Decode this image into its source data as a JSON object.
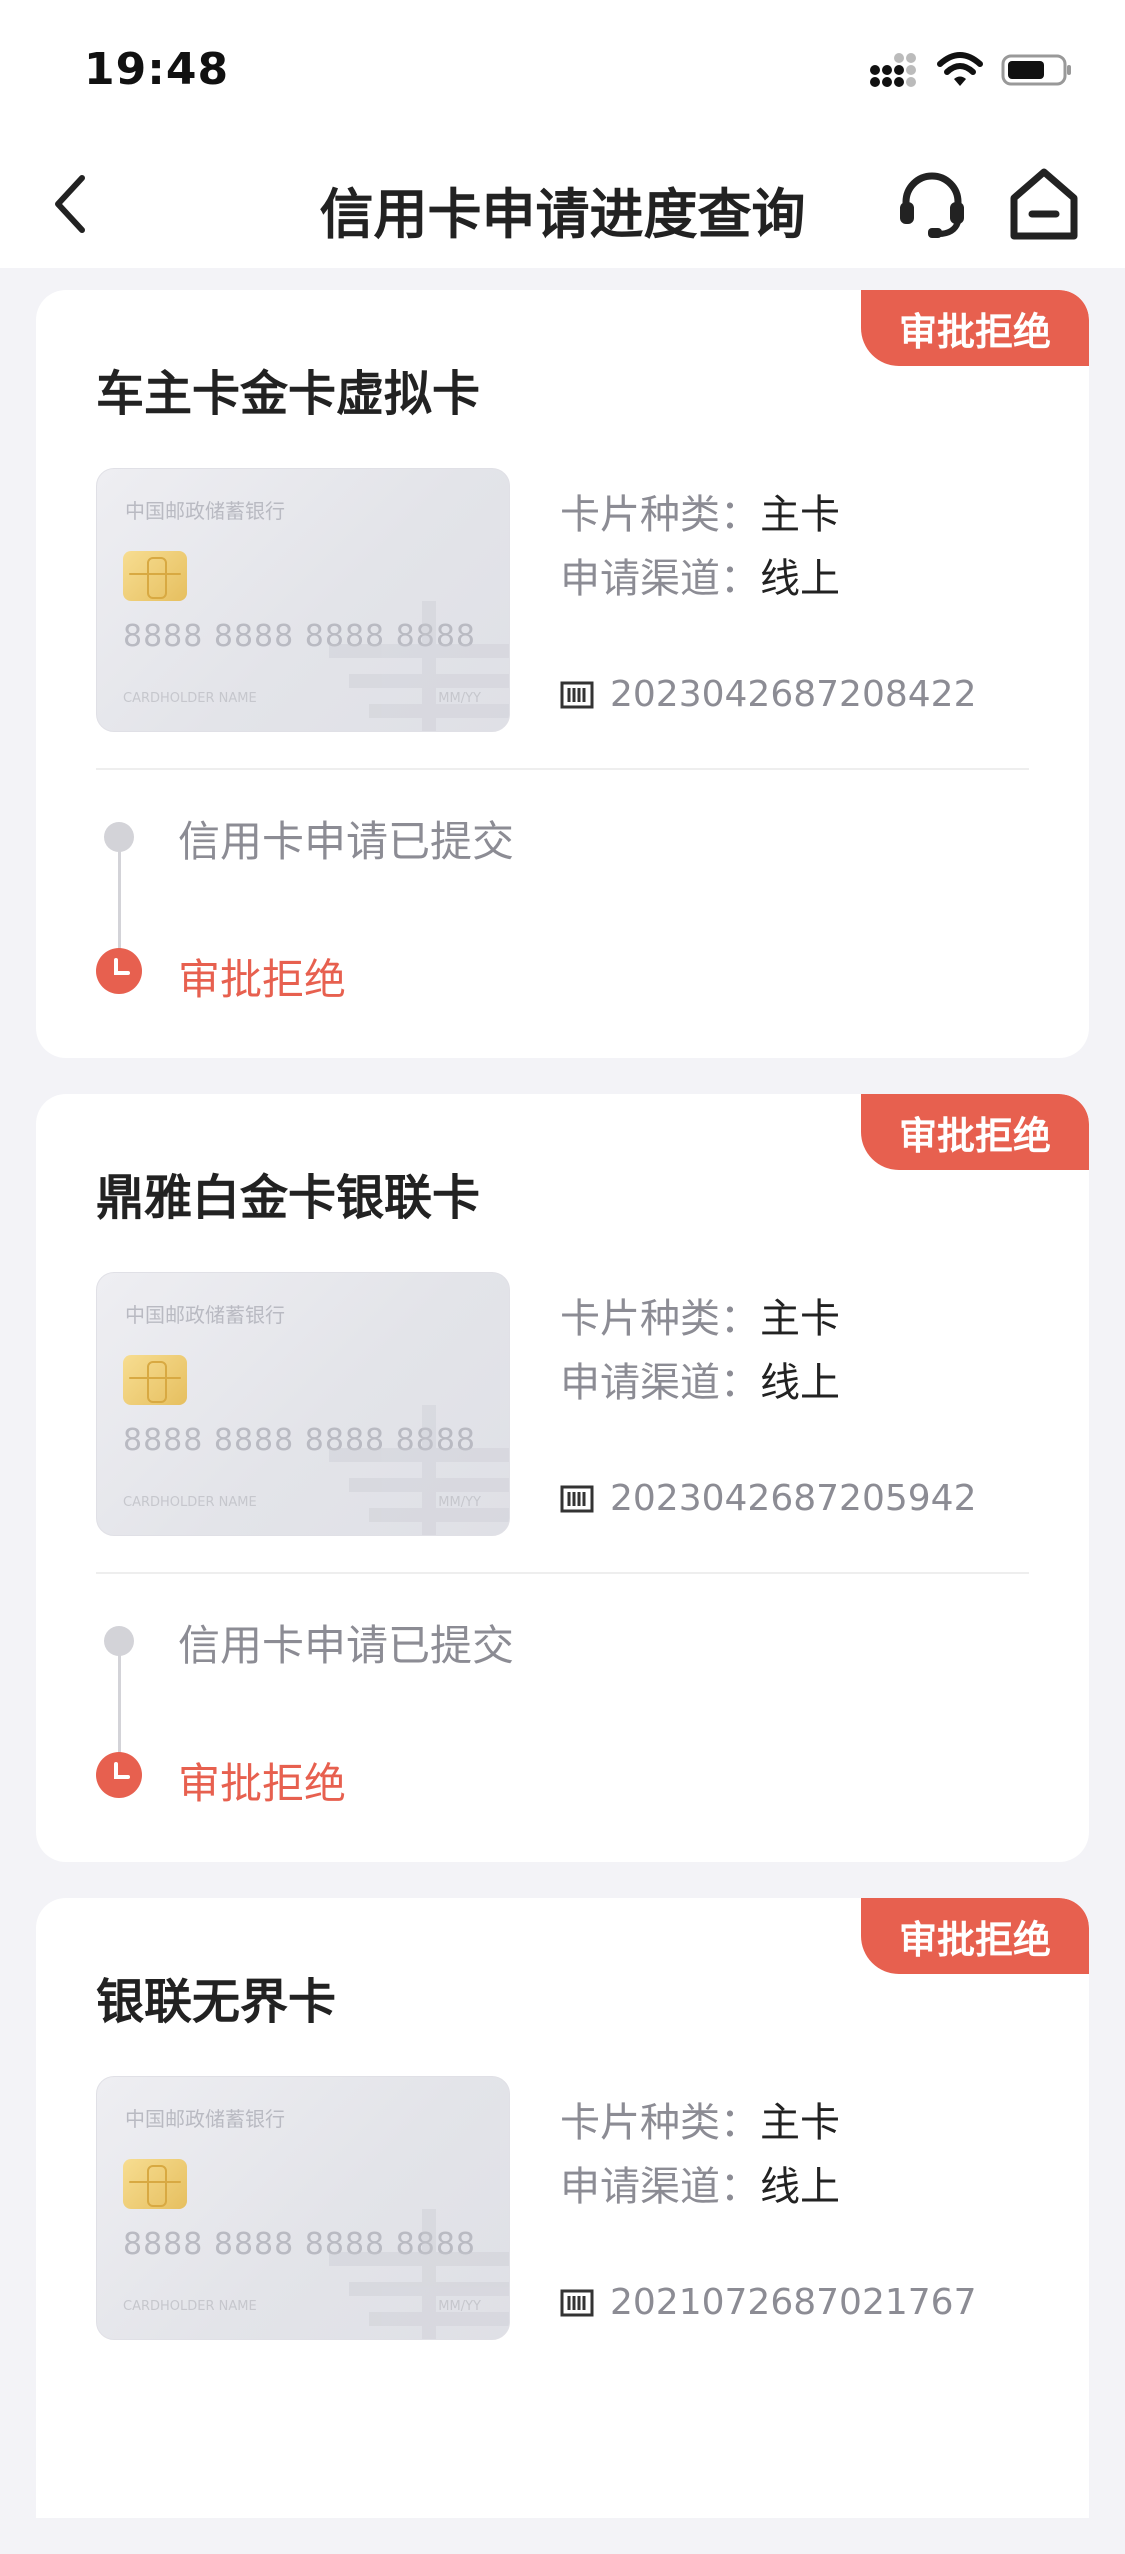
{
  "status_bar": {
    "time": "19:48",
    "icons": [
      "signal-icon",
      "wifi-icon",
      "battery-icon"
    ]
  },
  "nav": {
    "title": "信用卡申请进度查询",
    "icons": [
      "back-icon",
      "headset-icon",
      "home-icon"
    ]
  },
  "colors": {
    "accent": "#e7604f",
    "background": "#f3f3f7",
    "label": "#8c8c94"
  },
  "applications": [
    {
      "status_badge": "审批拒绝",
      "card_name": "车主卡金卡虚拟卡",
      "card_image": {
        "bank_name": "中国邮政储蓄银行",
        "card_number": "8888 8888 8888 8888",
        "holder": "CARDHOLDER NAME",
        "expiry": "MM/YY"
      },
      "card_type_label": "卡片种类：",
      "card_type_value": "主卡",
      "channel_label": "申请渠道：",
      "channel_value": "线上",
      "application_no": "2023042687208422",
      "steps": [
        "信用卡申请已提交",
        "审批拒绝"
      ]
    },
    {
      "status_badge": "审批拒绝",
      "card_name": "鼎雅白金卡银联卡",
      "card_image": {
        "bank_name": "中国邮政储蓄银行",
        "card_number": "8888 8888 8888 8888",
        "holder": "CARDHOLDER NAME",
        "expiry": "MM/YY"
      },
      "card_type_label": "卡片种类：",
      "card_type_value": "主卡",
      "channel_label": "申请渠道：",
      "channel_value": "线上",
      "application_no": "2023042687205942",
      "steps": [
        "信用卡申请已提交",
        "审批拒绝"
      ]
    },
    {
      "status_badge": "审批拒绝",
      "card_name": "银联无界卡",
      "card_image": {
        "bank_name": "中国邮政储蓄银行",
        "card_number": "8888 8888 8888 8888",
        "holder": "CARDHOLDER NAME",
        "expiry": "MM/YY"
      },
      "card_type_label": "卡片种类：",
      "card_type_value": "主卡",
      "channel_label": "申请渠道：",
      "channel_value": "线上",
      "application_no": "2021072687021767",
      "steps": []
    }
  ]
}
